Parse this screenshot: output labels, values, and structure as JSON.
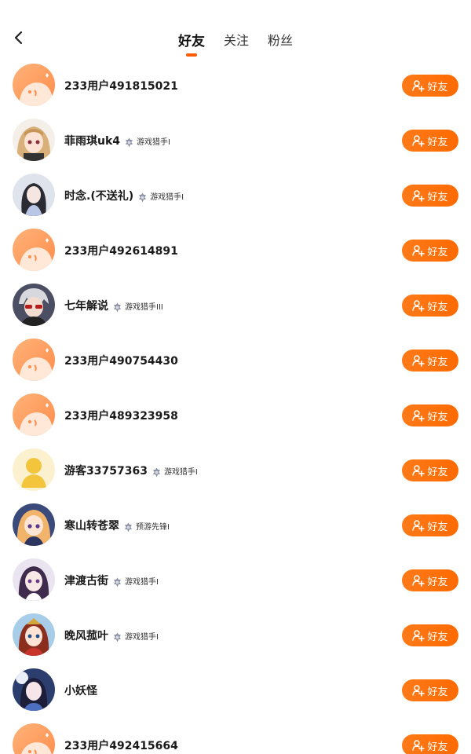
{
  "header": {
    "tabs": [
      {
        "label": "好友",
        "active": true
      },
      {
        "label": "关注",
        "active": false
      },
      {
        "label": "粉丝",
        "active": false
      }
    ]
  },
  "colors": {
    "accent": "#ff6a00",
    "indicator": "#ff5a00"
  },
  "add_button_label": "好友",
  "users": [
    {
      "name": "233用户491815021",
      "avatar": "default",
      "badge": ""
    },
    {
      "name": "菲雨琪uk4",
      "avatar": "anime-blonde",
      "badge": "游戏猎手I"
    },
    {
      "name": "时念.(不送礼)",
      "avatar": "anime-dark",
      "badge": "游戏猎手I"
    },
    {
      "name": "233用户492614891",
      "avatar": "default",
      "badge": ""
    },
    {
      "name": "七年解说",
      "avatar": "anime-silver",
      "badge": "游戏猎手III"
    },
    {
      "name": "233用户490754430",
      "avatar": "default",
      "badge": ""
    },
    {
      "name": "233用户489323958",
      "avatar": "default",
      "badge": ""
    },
    {
      "name": "游客33757363",
      "avatar": "guest",
      "badge": "游戏猎手I"
    },
    {
      "name": "寒山转苍翠",
      "avatar": "anime-orange",
      "badge": "预游先锋I"
    },
    {
      "name": "津渡古街",
      "avatar": "anime-purple",
      "badge": "游戏猎手I"
    },
    {
      "name": "晚风菰叶",
      "avatar": "anime-red",
      "badge": "游戏猎手I"
    },
    {
      "name": "小妖怪",
      "avatar": "anime-blue",
      "badge": ""
    },
    {
      "name": "233用户492415664",
      "avatar": "default",
      "badge": ""
    }
  ]
}
